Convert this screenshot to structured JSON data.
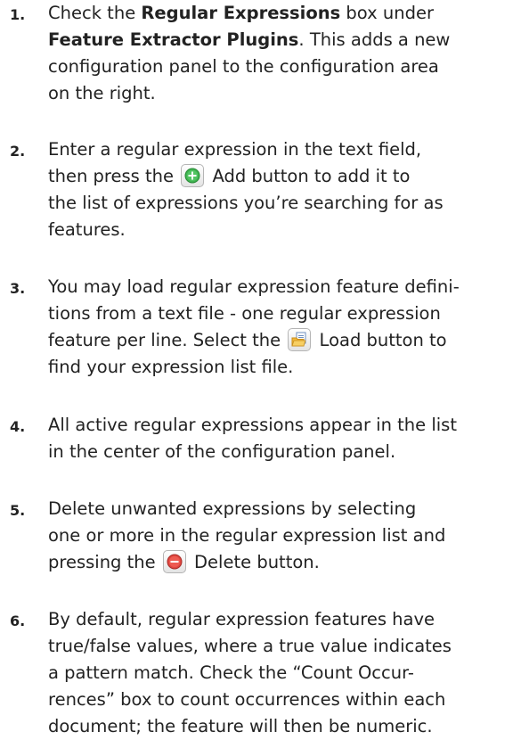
{
  "steps": [
    {
      "number": "1.",
      "lines": [
        {
          "t1": "Check the ",
          "b1": "Regular Expressions",
          "t2": " box under"
        },
        {
          "b1": "Feature Extractor Plugins",
          "t2": ". This adds a new"
        },
        {
          "text": "configuration panel to the configuration area"
        },
        {
          "text": "on the right."
        }
      ]
    },
    {
      "number": "2.",
      "lines": [
        {
          "text": "Enter a regular expression in the text field,"
        },
        {
          "before": "then press the",
          "after": "Add button to add it to",
          "icon": "add-icon"
        },
        {
          "text": "the list of expressions you’re searching for as"
        },
        {
          "text": "features."
        }
      ]
    },
    {
      "number": "3.",
      "lines": [
        {
          "text": "You may load regular expression feature defini-"
        },
        {
          "text": "tions from a text file - one regular expression"
        },
        {
          "before": "feature per line. Select the",
          "after": "Load button to",
          "icon": "load-icon"
        },
        {
          "text": "find your expression list file."
        }
      ]
    },
    {
      "number": "4.",
      "lines": [
        {
          "text": "All active regular expressions appear in the list"
        },
        {
          "text": "in the center of the configuration panel."
        }
      ]
    },
    {
      "number": "5.",
      "lines": [
        {
          "text": "Delete unwanted expressions by selecting"
        },
        {
          "text": "one or more in the regular expression list and"
        },
        {
          "before": "pressing the",
          "after": "Delete button.",
          "icon": "delete-icon"
        }
      ]
    },
    {
      "number": "6.",
      "lines": [
        {
          "text": " By default, regular expression features have"
        },
        {
          "text": "true/false values, where a true value  indicates"
        },
        {
          "text": "a pattern match. Check the “Count Occur-"
        },
        {
          "text": "rences” box to count occurrences within each"
        },
        {
          "text": "document; the feature will then be numeric."
        }
      ]
    }
  ],
  "colors": {
    "text": "#222222",
    "add_green": "#3fb34f",
    "delete_red": "#e0463f",
    "load_folder": "#f2b93b"
  }
}
